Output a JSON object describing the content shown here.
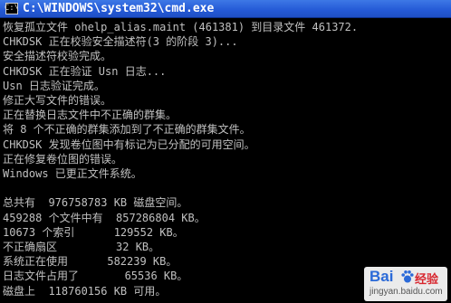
{
  "window": {
    "title": "C:\\WINDOWS\\system32\\cmd.exe",
    "icon": "cmd-icon",
    "icon_glyph": "C:\\"
  },
  "console": {
    "text_color": "#c0c0c0",
    "background": "#000000",
    "lines": [
      "恢复孤立文件 ohelp_alias.maint (461381) 到目录文件 461372.",
      "CHKDSK 正在校验安全描述符(3 的阶段 3)...",
      "安全描述符校验完成。",
      "CHKDSK 正在验证 Usn 日志...",
      "Usn 日志验证完成。",
      "修正大写文件的错误。",
      "正在替换日志文件中不正确的群集。",
      "将 8 个不正确的群集添加到了不正确的群集文件。",
      "CHKDSK 发现卷位图中有标记为已分配的可用空间。",
      "正在修复卷位图的错误。",
      "Windows 已更正文件系统。",
      "",
      "总共有  976758783 KB 磁盘空间。",
      "459288 个文件中有  857286804 KB。",
      "10673 个索引      129552 KB。",
      "不正确扇区         32 KB。",
      "系统正在使用      582239 KB。",
      "日志文件占用了       65536 KB。",
      "磁盘上  118760156 KB 可用。"
    ]
  },
  "watermark": {
    "brand": "Bai",
    "sub": "经验",
    "url": "jingyan.baidu.com",
    "icon": "baidu-paw-icon"
  }
}
